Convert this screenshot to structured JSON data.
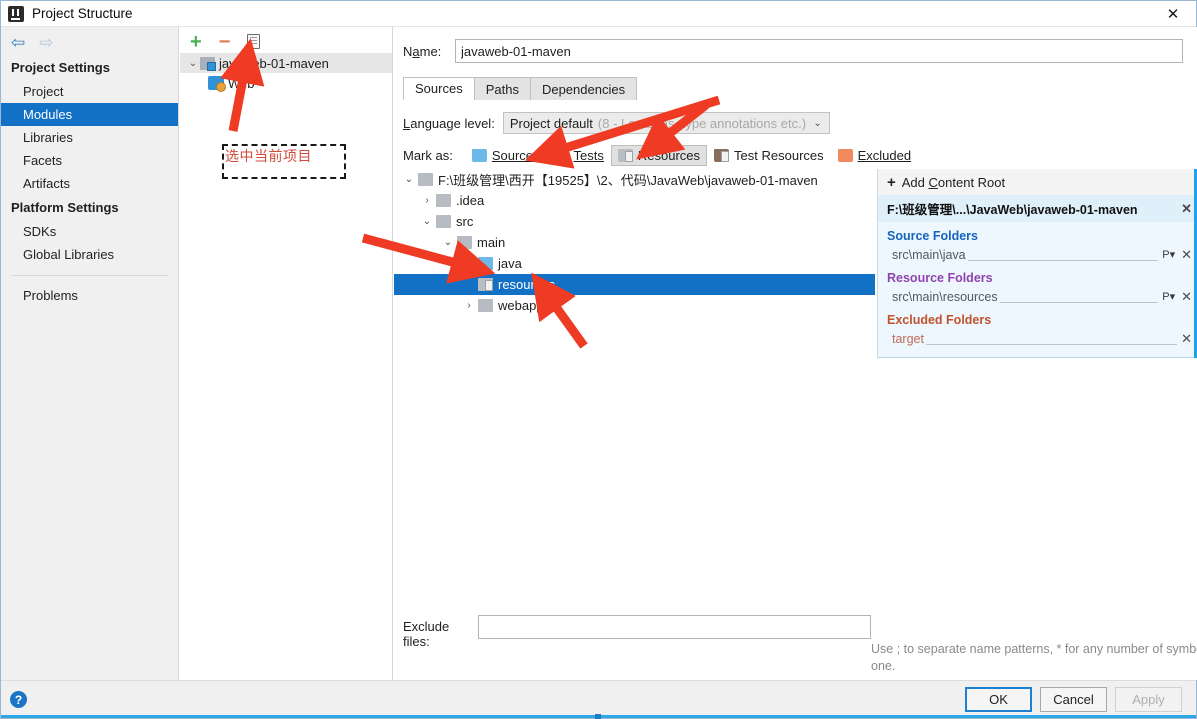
{
  "window": {
    "title": "Project Structure",
    "app_icon": "intellij-idea-icon",
    "close_label": "✕"
  },
  "nav": {
    "back_icon": "⇦",
    "forward_icon": "⇨",
    "sections": [
      {
        "title": "Project Settings",
        "items": [
          {
            "label": "Project",
            "selected": false
          },
          {
            "label": "Modules",
            "selected": true
          },
          {
            "label": "Libraries",
            "selected": false
          },
          {
            "label": "Facets",
            "selected": false
          },
          {
            "label": "Artifacts",
            "selected": false
          }
        ]
      },
      {
        "title": "Platform Settings",
        "items": [
          {
            "label": "SDKs",
            "selected": false
          },
          {
            "label": "Global Libraries",
            "selected": false
          }
        ]
      }
    ],
    "problems_label": "Problems"
  },
  "modules_panel": {
    "toolbar": {
      "add_label": "+",
      "remove_label": "−",
      "copy_label": "copy-icon"
    },
    "tree": [
      {
        "label": "javaweb-01-maven",
        "twisty": "⌄",
        "icon": "module-icon",
        "selected": true,
        "indent": 0
      },
      {
        "label": "Web",
        "twisty": "",
        "icon": "web-facet-icon",
        "selected": false,
        "indent": 1
      }
    ]
  },
  "annotation": {
    "note_text": "选中当前项目",
    "accent_color": "#e8402a"
  },
  "main": {
    "name_label": "Name:",
    "name_value": "javaweb-01-maven",
    "name_placeholder": "",
    "tabs": [
      {
        "label": "Sources",
        "active": true
      },
      {
        "label": "Paths",
        "active": false
      },
      {
        "label": "Dependencies",
        "active": false
      }
    ],
    "language_level": {
      "label": "Language level:",
      "value": "Project default",
      "value_hint": "(8 - Lambdas, type annotations etc.)",
      "caret": "⌄"
    },
    "mark_as": {
      "label": "Mark as:",
      "options": [
        {
          "label": "Sources",
          "color": "#6cb8e8",
          "kind": "blue",
          "pressed": false
        },
        {
          "label": "Tests",
          "color": "#87c162",
          "kind": "green",
          "pressed": false
        },
        {
          "label": "Resources",
          "color": "#b9bec4",
          "kind": "gray",
          "pressed": true
        },
        {
          "label": "Test Resources",
          "color": "#8a6d5a",
          "kind": "graysm",
          "pressed": false
        },
        {
          "label": "Excluded",
          "color": "#f08a5d",
          "kind": "orange",
          "pressed": false
        }
      ]
    },
    "file_tree": [
      {
        "label": "F:\\班级管理\\西开【19525】\\2、代码\\JavaWeb\\javaweb-01-maven",
        "twisty": "⌄",
        "indent": 0,
        "folder": "gray",
        "selected": false
      },
      {
        "label": ".idea",
        "twisty": "›",
        "indent": 1,
        "folder": "gray",
        "selected": false
      },
      {
        "label": "src",
        "twisty": "⌄",
        "indent": 1,
        "folder": "gray",
        "selected": false
      },
      {
        "label": "main",
        "twisty": "⌄",
        "indent": 2,
        "folder": "gray",
        "selected": false
      },
      {
        "label": "java",
        "twisty": "",
        "indent": 3,
        "folder": "blue",
        "selected": false
      },
      {
        "label": "resources",
        "twisty": "",
        "indent": 3,
        "folder": "res",
        "selected": true
      },
      {
        "label": "webapp",
        "twisty": "›",
        "indent": 3,
        "folder": "gray",
        "selected": false
      }
    ],
    "exclude_files": {
      "label": "Exclude files:",
      "value": "",
      "hint": "Use ; to separate name patterns, * for any number of symbols, ? for one."
    }
  },
  "content_root": {
    "add_label": "Add Content Root",
    "add_icon": "plus-icon",
    "root_path": "F:\\班级管理\\...\\JavaWeb\\javaweb-01-maven",
    "root_remove_icon": "✕",
    "groups": [
      {
        "title": "Source Folders",
        "color": "#1565c0",
        "kind": "src",
        "entries": [
          {
            "path": "src\\main\\java",
            "package_icon": "P▾",
            "remove_icon": "✕"
          }
        ]
      },
      {
        "title": "Resource Folders",
        "color": "#8e44ad",
        "kind": "res",
        "entries": [
          {
            "path": "src\\main\\resources",
            "package_icon": "P▾",
            "remove_icon": "✕"
          }
        ]
      },
      {
        "title": "Excluded Folders",
        "color": "#c0522c",
        "kind": "exc",
        "entries": [
          {
            "path": "target",
            "package_icon": "",
            "remove_icon": "✕"
          }
        ]
      }
    ]
  },
  "footer": {
    "help_label": "?",
    "buttons": [
      {
        "label": "OK",
        "state": "default-focused"
      },
      {
        "label": "Cancel",
        "state": "normal"
      },
      {
        "label": "Apply",
        "state": "disabled"
      }
    ]
  }
}
